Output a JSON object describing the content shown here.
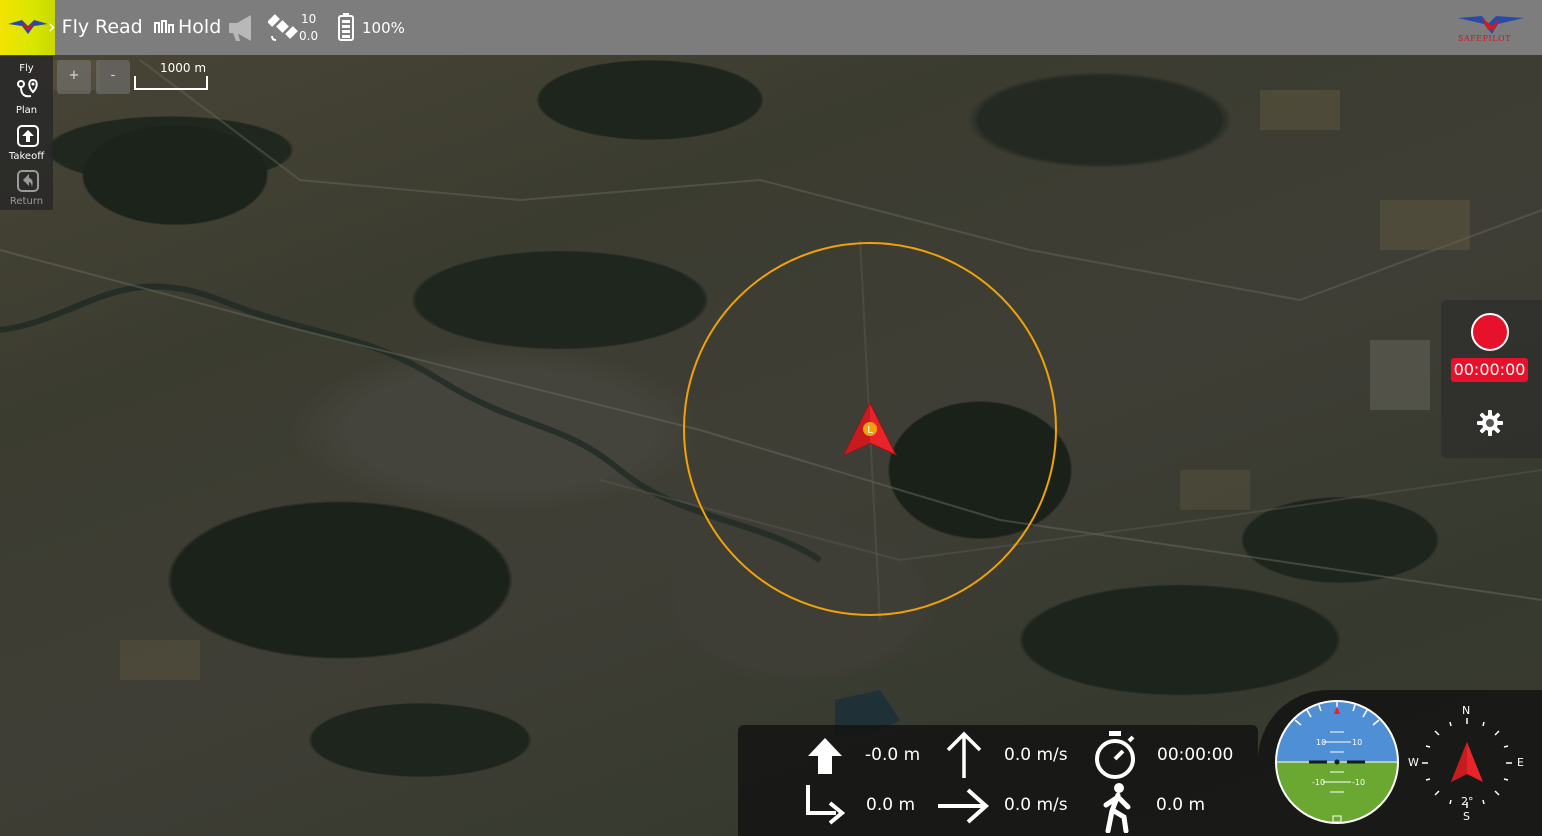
{
  "toolbar": {
    "flight_mode_partial": "Fly",
    "status": "Ready",
    "mode": "Hold",
    "satellite_count": "10",
    "hdop": "0.0",
    "battery": "100%"
  },
  "brand": {
    "logo_text": "SAFEPILOT"
  },
  "tools": {
    "fly": "Fly",
    "plan": "Plan",
    "takeoff": "Takeoff",
    "return": "Return"
  },
  "map": {
    "zoom_in": "+",
    "zoom_out": "-",
    "scale": "1000 m",
    "vehicle_label": "L",
    "geofence_color": "#f0a20a",
    "vehicle_color": "#e8242a"
  },
  "recorder": {
    "time": "00:00:00",
    "color": "#e8112b"
  },
  "values": {
    "altitude": "-0.0 m",
    "vertical_speed": "0.0 m/s",
    "flight_time": "00:00:00",
    "distance_home": "0.0 m",
    "horizontal_speed": "0.0 m/s",
    "distance_ground": "0.0 m"
  },
  "attitude": {
    "pitch_labels": [
      "10",
      "10",
      "-10",
      "-10"
    ],
    "sky_color": "#4f8fd6",
    "ground_color": "#6aa832"
  },
  "compass": {
    "n": "N",
    "e": "E",
    "s": "S",
    "w": "W",
    "heading": "2°"
  },
  "icons": [
    "megaphone-icon",
    "satellite-icon",
    "battery-icon",
    "plan-icon",
    "takeoff-icon",
    "return-icon",
    "gear-icon",
    "arrow-up-icon",
    "vertical-speed-icon",
    "stopwatch-icon",
    "home-distance-icon",
    "horizontal-speed-icon",
    "walker-icon"
  ]
}
